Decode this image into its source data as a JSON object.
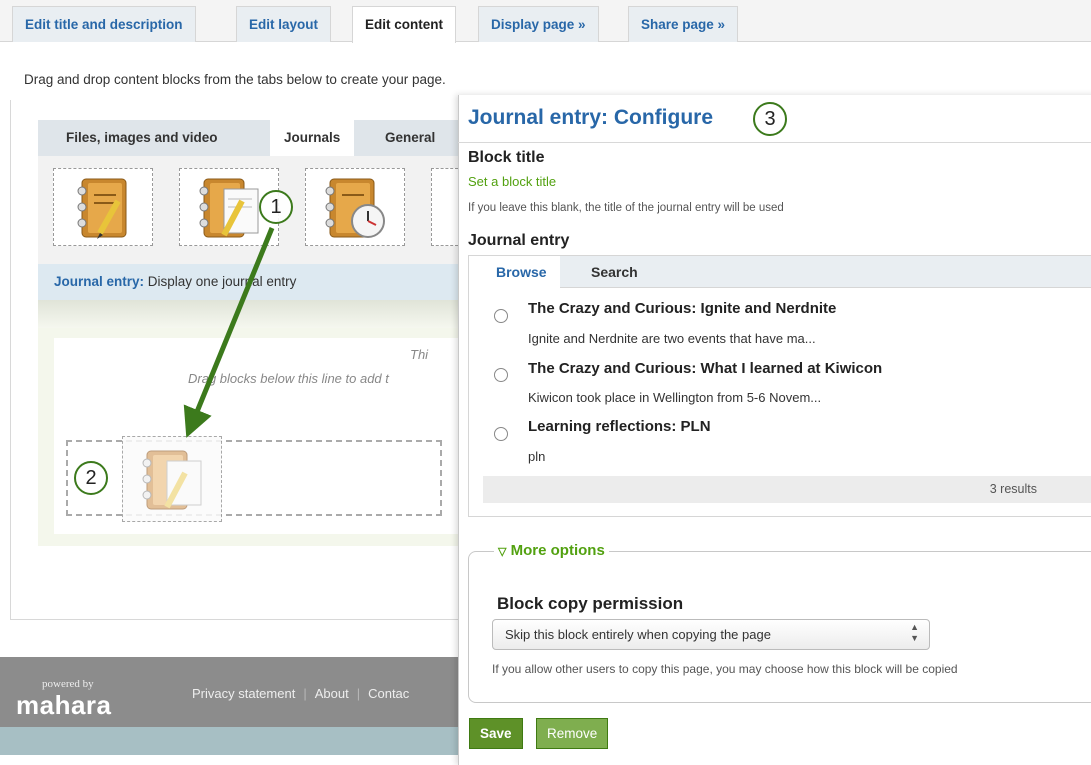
{
  "top_tabs": [
    {
      "label": "Edit title and description"
    },
    {
      "label": "Edit layout"
    },
    {
      "label": "Edit content"
    },
    {
      "label": "Display page »"
    },
    {
      "label": "Share page »"
    }
  ],
  "instructions": "Drag and drop content blocks from the tabs below to create your page.",
  "category_tabs": [
    {
      "label": "Files, images and video"
    },
    {
      "label": "Journals"
    },
    {
      "label": "General"
    }
  ],
  "block_description": {
    "name": "Journal entry:",
    "text": " Display one journal entry"
  },
  "drop_hint_a": "Thi",
  "drop_hint_b": "Drag blocks below this line to add t",
  "footer": {
    "powered_by": "powered by",
    "logo_text": "mahara",
    "links": [
      "Privacy statement",
      "About",
      "Contac"
    ]
  },
  "callouts": {
    "one": "1",
    "two": "2",
    "three": "3"
  },
  "panel": {
    "title": "Journal entry: Configure",
    "block_title_label": "Block title",
    "set_title_link": "Set a block title",
    "title_help": "If you leave this blank, the title of the journal entry will be used",
    "journal_entry_label": "Journal entry",
    "browse_tabs": [
      {
        "label": "Browse"
      },
      {
        "label": "Search"
      }
    ],
    "entries": [
      {
        "title": "The Crazy and Curious: Ignite and Nerdnite",
        "excerpt": "Ignite and Nerdnite are two events that have ma..."
      },
      {
        "title": "The Crazy and Curious: What I learned at Kiwicon",
        "excerpt": "Kiwicon took place in Wellington from 5-6 Novem..."
      },
      {
        "title": "Learning reflections: PLN",
        "excerpt": "pln"
      }
    ],
    "results": "3 results",
    "more_options": "More options",
    "copy_permission_label": "Block copy permission",
    "copy_permission_value": "Skip this block entirely when copying the page",
    "copy_help": "If you allow other users to copy this page, you may choose how this block will be copied",
    "save_label": "Save",
    "remove_label": "Remove"
  },
  "colors": {
    "link_blue": "#2867a8",
    "green": "#52a110",
    "button_green": "#5e9128",
    "callout_green": "#3c7a1c"
  },
  "icons": [
    "journal-notebook-icon",
    "journal-edit-icon",
    "journal-clock-icon",
    "sort-arrows-icon",
    "triangle-down-icon"
  ]
}
